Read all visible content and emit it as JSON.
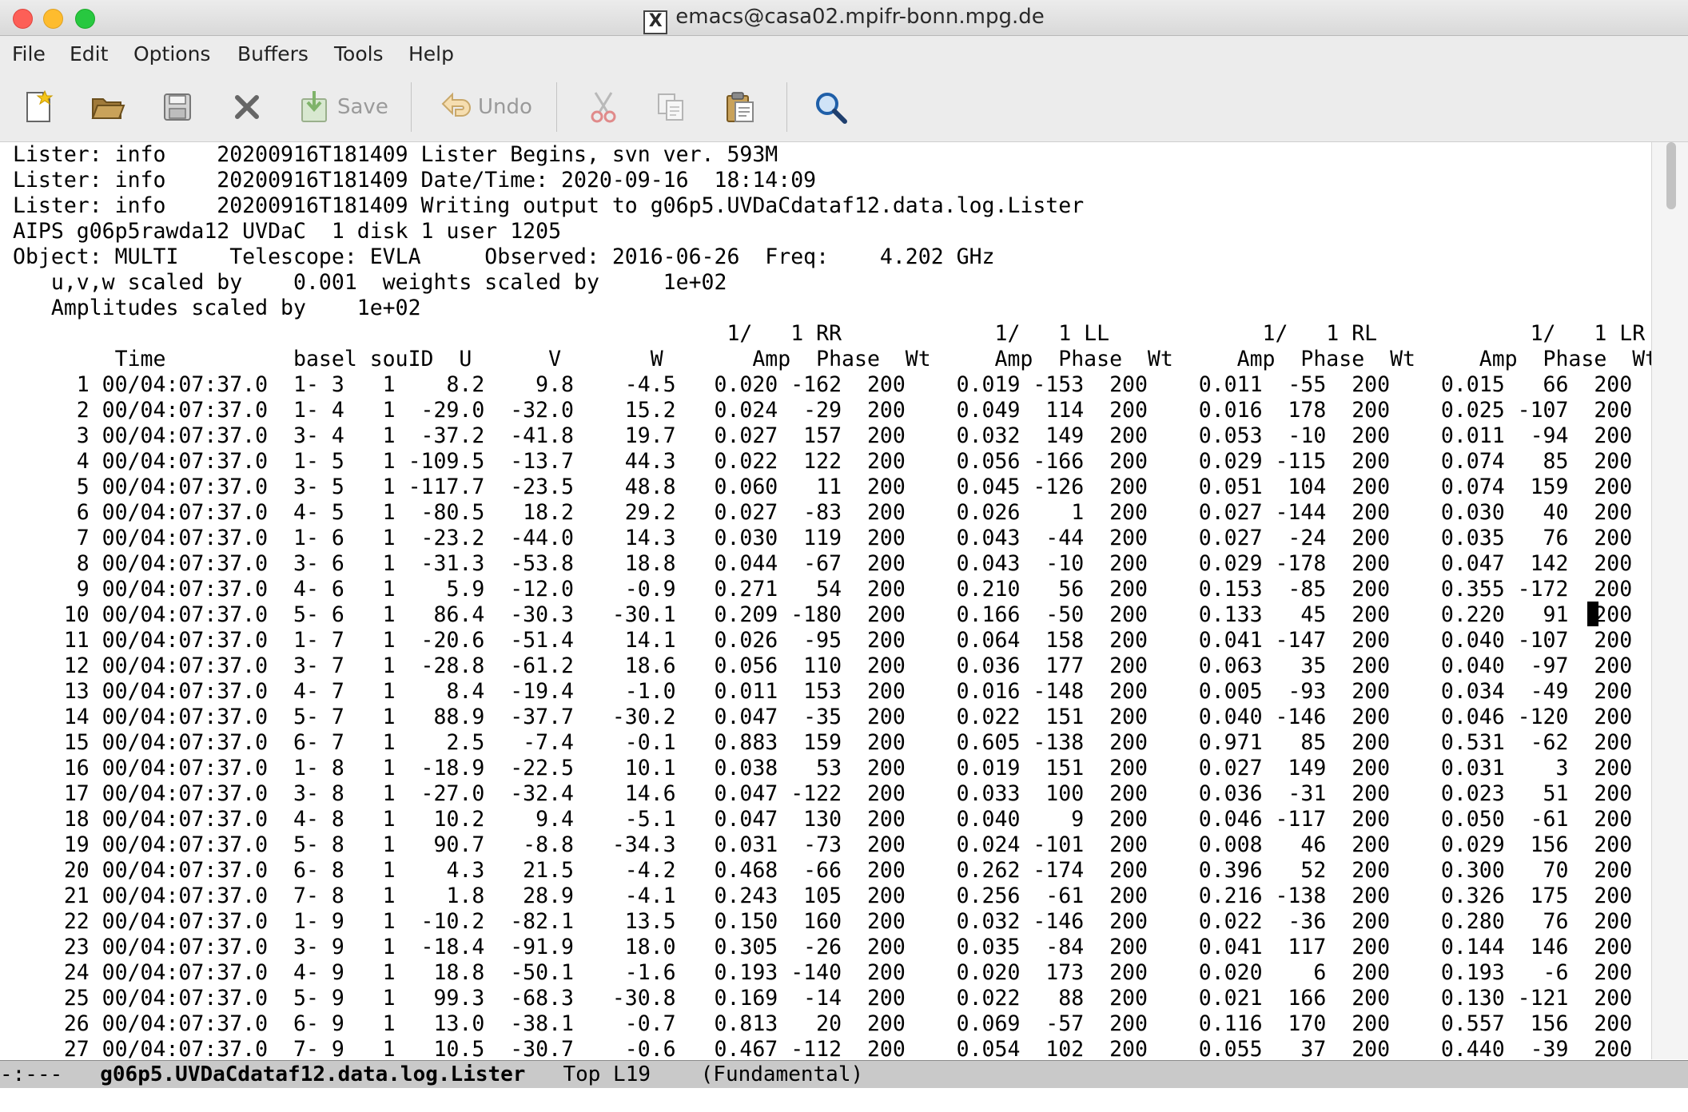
{
  "window": {
    "title": "emacs@casa02.mpifr-bonn.mpg.de",
    "title_icon": "x11-icon",
    "title_icon_glyph": "X"
  },
  "menubar": {
    "items": [
      "File",
      "Edit",
      "Options",
      "Buffers",
      "Tools",
      "Help"
    ]
  },
  "toolbar": {
    "new_icon": "new-file-icon",
    "open_icon": "open-folder-icon",
    "disk_icon": "floppy-disk-icon",
    "close_icon": "close-buffer-icon",
    "save_label": "Save",
    "undo_label": "Undo",
    "cut_icon": "scissors-icon",
    "copy_icon": "copy-icon",
    "paste_icon": "clipboard-icon",
    "search_icon": "magnifier-icon"
  },
  "buffer": {
    "lines": [
      "Lister: info    20200916T181409 Lister Begins, svn ver. 593M",
      "Lister: info    20200916T181409 Date/Time: 2020-09-16  18:14:09",
      "Lister: info    20200916T181409 Writing output to g06p5.UVDaCdataf12.data.log.Lister",
      "AIPS g06p5rawda12 UVDaC  1 disk 1 user 1205",
      "Object: MULTI    Telescope: EVLA     Observed: 2016-06-26  Freq:    4.202 GHz",
      "   u,v,w scaled by    0.001  weights scaled by     1e+02",
      "   Amplitudes scaled by    1e+02",
      "                                                        1/   1 RR            1/   1 LL            1/   1 RL            1/   1 LR",
      "        Time          basel souID  U      V       W       Amp  Phase  Wt     Amp  Phase  Wt     Amp  Phase  Wt     Amp  Phase  Wt",
      "     1 00/04:07:37.0  1- 3   1    8.2    9.8    -4.5   0.020 -162  200    0.019 -153  200    0.011  -55  200    0.015   66  200",
      "     2 00/04:07:37.0  1- 4   1  -29.0  -32.0    15.2   0.024  -29  200    0.049  114  200    0.016  178  200    0.025 -107  200",
      "     3 00/04:07:37.0  3- 4   1  -37.2  -41.8    19.7   0.027  157  200    0.032  149  200    0.053  -10  200    0.011  -94  200",
      "     4 00/04:07:37.0  1- 5   1 -109.5  -13.7    44.3   0.022  122  200    0.056 -166  200    0.029 -115  200    0.074   85  200",
      "     5 00/04:07:37.0  3- 5   1 -117.7  -23.5    48.8   0.060   11  200    0.045 -126  200    0.051  104  200    0.074  159  200",
      "     6 00/04:07:37.0  4- 5   1  -80.5   18.2    29.2   0.027  -83  200    0.026    1  200    0.027 -144  200    0.030   40  200",
      "     7 00/04:07:37.0  1- 6   1  -23.2  -44.0    14.3   0.030  119  200    0.043  -44  200    0.027  -24  200    0.035   76  200",
      "     8 00/04:07:37.0  3- 6   1  -31.3  -53.8    18.8   0.044  -67  200    0.043  -10  200    0.029 -178  200    0.047  142  200",
      "     9 00/04:07:37.0  4- 6   1    5.9  -12.0    -0.9   0.271   54  200    0.210   56  200    0.153  -85  200    0.355 -172  200",
      "    10 00/04:07:37.0  5- 6   1   86.4  -30.3   -30.1   0.209 -180  200    0.166  -50  200    0.133   45  200    0.220   91  200",
      "    11 00/04:07:37.0  1- 7   1  -20.6  -51.4    14.1   0.026  -95  200    0.064  158  200    0.041 -147  200    0.040 -107  200",
      "    12 00/04:07:37.0  3- 7   1  -28.8  -61.2    18.6   0.056  110  200    0.036  177  200    0.063   35  200    0.040  -97  200",
      "    13 00/04:07:37.0  4- 7   1    8.4  -19.4    -1.0   0.011  153  200    0.016 -148  200    0.005  -93  200    0.034  -49  200",
      "    14 00/04:07:37.0  5- 7   1   88.9  -37.7   -30.2   0.047  -35  200    0.022  151  200    0.040 -146  200    0.046 -120  200",
      "    15 00/04:07:37.0  6- 7   1    2.5   -7.4    -0.1   0.883  159  200    0.605 -138  200    0.971   85  200    0.531  -62  200",
      "    16 00/04:07:37.0  1- 8   1  -18.9  -22.5    10.1   0.038   53  200    0.019  151  200    0.027  149  200    0.031    3  200",
      "    17 00/04:07:37.0  3- 8   1  -27.0  -32.4    14.6   0.047 -122  200    0.033  100  200    0.036  -31  200    0.023   51  200",
      "    18 00/04:07:37.0  4- 8   1   10.2    9.4    -5.1   0.047  130  200    0.040    9  200    0.046 -117  200    0.050  -61  200",
      "    19 00/04:07:37.0  5- 8   1   90.7   -8.8   -34.3   0.031  -73  200    0.024 -101  200    0.008   46  200    0.029  156  200",
      "    20 00/04:07:37.0  6- 8   1    4.3   21.5    -4.2   0.468  -66  200    0.262 -174  200    0.396   52  200    0.300   70  200",
      "    21 00/04:07:37.0  7- 8   1    1.8   28.9    -4.1   0.243  105  200    0.256  -61  200    0.216 -138  200    0.326  175  200",
      "    22 00/04:07:37.0  1- 9   1  -10.2  -82.1    13.5   0.150  160  200    0.032 -146  200    0.022  -36  200    0.280   76  200",
      "    23 00/04:07:37.0  3- 9   1  -18.4  -91.9    18.0   0.305  -26  200    0.035  -84  200    0.041  117  200    0.144  146  200",
      "    24 00/04:07:37.0  4- 9   1   18.8  -50.1    -1.6   0.193 -140  200    0.020  173  200    0.020    6  200    0.193   -6  200",
      "    25 00/04:07:37.0  5- 9   1   99.3  -68.3   -30.8   0.169  -14  200    0.022   88  200    0.021  166  200    0.130 -121  200",
      "    26 00/04:07:37.0  6- 9   1   13.0  -38.1    -0.7   0.813   20  200    0.069  -57  200    0.116  170  200    0.557  156  200",
      "    27 00/04:07:37.0  7- 9   1   10.5  -30.7    -0.6   0.467 -112  200    0.054  102  200    0.055   37  200    0.440  -39  200"
    ]
  },
  "modeline": {
    "status": "-:---",
    "buffer_name": "g06p5.UVDaCdataf12.data.log.Lister",
    "position": "Top L19",
    "mode": "(Fundamental)"
  }
}
